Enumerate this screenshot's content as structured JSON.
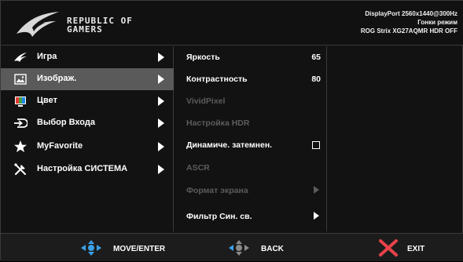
{
  "header": {
    "logo_line1": "REPUBLIC OF",
    "logo_line2": "GAMERS",
    "status_line1": "DisplayPort 2560x1440@300Hz",
    "status_line2": "Гонки режим",
    "status_line3": "ROG Strix XG27AQMR HDR OFF"
  },
  "main_menu": [
    {
      "label": "Игра",
      "icon": "rog-eye-icon",
      "selected": false
    },
    {
      "label": "Изображ.",
      "icon": "image-icon",
      "selected": true
    },
    {
      "label": "Цвет",
      "icon": "color-icon",
      "selected": false
    },
    {
      "label": "Выбор Входа",
      "icon": "input-select-icon",
      "selected": false
    },
    {
      "label": "MyFavorite",
      "icon": "star-icon",
      "selected": false
    },
    {
      "label": "Настройка СИСТЕМА",
      "icon": "wrench-screwdriver-icon",
      "selected": false
    }
  ],
  "sub_menu": [
    {
      "label": "Яркость",
      "value": "65",
      "enabled": true
    },
    {
      "label": "Контрастность",
      "value": "80",
      "enabled": true
    },
    {
      "label": "VividPixel",
      "enabled": false
    },
    {
      "label": "Настройка HDR",
      "enabled": false
    },
    {
      "label": "Динамиче. затемнен.",
      "control": "checkbox",
      "checked": false,
      "enabled": true
    },
    {
      "label": "ASCR",
      "enabled": false
    },
    {
      "label": "Формат экрана",
      "control": "arrow",
      "enabled": false
    },
    {
      "label": "Фильтр Син. св.",
      "control": "arrow",
      "enabled": true
    }
  ],
  "footer": {
    "move_label": "MOVE/ENTER",
    "back_label": "BACK",
    "exit_label": "EXIT"
  },
  "colors": {
    "accent_blue": "#3aa0e8",
    "exit_red": "#e8424a",
    "selected_bg": "#5a5a5a",
    "disabled_text": "#5c5c5c"
  }
}
